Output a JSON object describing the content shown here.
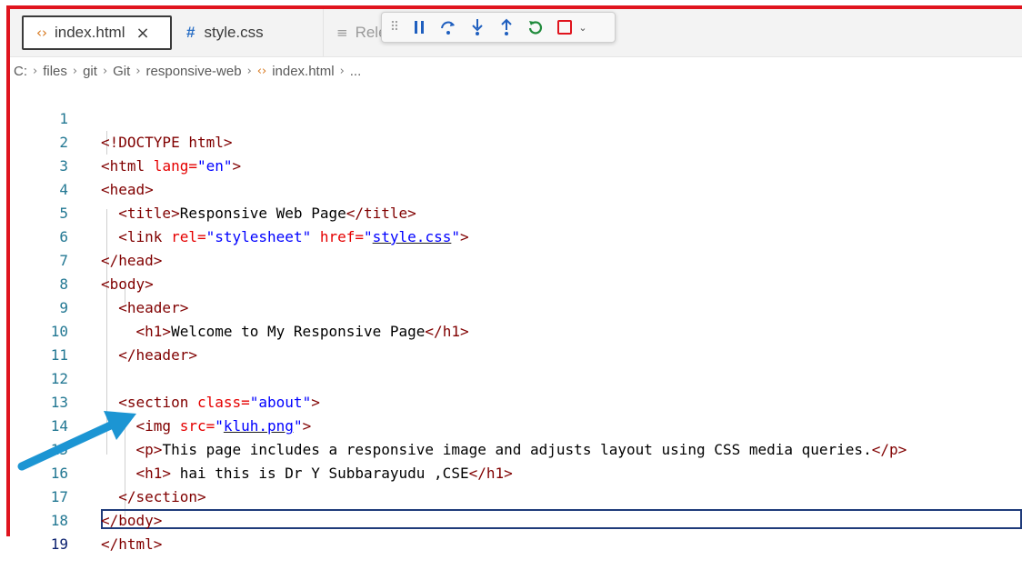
{
  "tabs": [
    {
      "label": "index.html",
      "icon": "html-file-icon",
      "close": "×"
    },
    {
      "label": "style.css",
      "icon": "css-file-icon"
    },
    {
      "label": "Rele",
      "icon": "lines-icon"
    }
  ],
  "debug_toolbar": {
    "buttons": [
      "drag-grip",
      "pause",
      "step-over",
      "step-into",
      "step-out",
      "restart",
      "stop",
      "more"
    ]
  },
  "breadcrumb": [
    "C:",
    "files",
    "git",
    "Git",
    "responsive-web",
    "index.html",
    "..."
  ],
  "code_lines": [
    {
      "n": "1"
    },
    {
      "n": "2"
    },
    {
      "n": "3"
    },
    {
      "n": "4"
    },
    {
      "n": "5"
    },
    {
      "n": "6"
    },
    {
      "n": "7"
    },
    {
      "n": "8"
    },
    {
      "n": "9"
    },
    {
      "n": "10"
    },
    {
      "n": "11"
    },
    {
      "n": "12"
    },
    {
      "n": "13"
    },
    {
      "n": "14"
    },
    {
      "n": "15"
    },
    {
      "n": "16"
    },
    {
      "n": "17"
    },
    {
      "n": "18"
    },
    {
      "n": "19"
    }
  ],
  "code": {
    "doctype": "<!DOCTYPE html>",
    "html_open": "<html",
    "lang_attr": " lang=",
    "lang_val": "\"en\"",
    "gt": ">",
    "head_open": "<head>",
    "title_open": "<title>",
    "title_text": "Responsive Web Page",
    "title_close": "</title>",
    "link_open": "<link",
    "rel_attr": " rel=",
    "rel_val": "\"stylesheet\"",
    "href_attr": " href=",
    "q": "\"",
    "href_val": "style.css",
    "head_close": "</head>",
    "body_open": "<body>",
    "header_open": "<header>",
    "h1_open": "<h1>",
    "h1_text": "Welcome to My Responsive Page",
    "h1_close": "</h1>",
    "header_close": "</header>",
    "section_open": "<section",
    "class_attr": " class=",
    "class_val": "\"about\"",
    "img_open": "<img",
    "src_attr": " src=",
    "src_val": "kluh.png",
    "p_open": "<p>",
    "p_text": "This page includes a responsive image and adjusts layout using CSS media queries.",
    "p_close": "</p>",
    "h1b_text": " hai this is Dr Y Subbarayudu ,CSE",
    "section_close": "</section>",
    "body_close": "</body>",
    "html_close": "</html>"
  },
  "colors": {
    "frame": "#e0141e",
    "tag": "#800000",
    "attr": "#e50000",
    "string": "#0000ff",
    "line_number": "#237893",
    "arrow": "#1c95d3"
  }
}
